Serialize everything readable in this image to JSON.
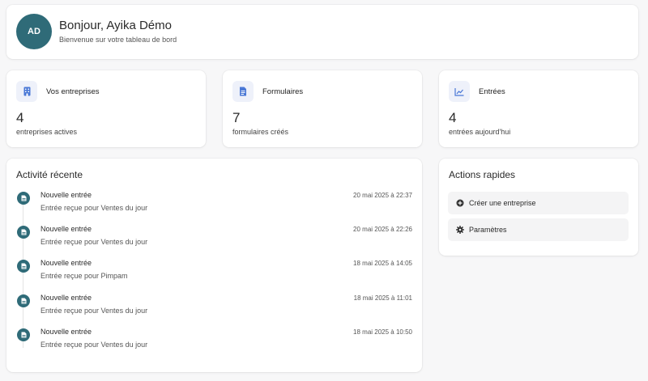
{
  "header": {
    "avatar_initials": "AD",
    "greeting": "Bonjour, Ayika Démo",
    "subtitle": "Bienvenue sur votre tableau de bord"
  },
  "stats": [
    {
      "label": "Vos entreprises",
      "value": "4",
      "description": "entreprises actives",
      "icon": "building-icon"
    },
    {
      "label": "Formulaires",
      "value": "7",
      "description": "formulaires créés",
      "icon": "document-icon"
    },
    {
      "label": "Entrées",
      "value": "4",
      "description": "entrées aujourd'hui",
      "icon": "line-chart-icon"
    }
  ],
  "activity": {
    "title": "Activité récente",
    "items": [
      {
        "title": "Nouvelle entrée",
        "description": "Entrée reçue pour Ventes du jour",
        "time": "20 mai 2025 à 22:37"
      },
      {
        "title": "Nouvelle entrée",
        "description": "Entrée reçue pour Ventes du jour",
        "time": "20 mai 2025 à 22:26"
      },
      {
        "title": "Nouvelle entrée",
        "description": "Entrée reçue pour Pimpam",
        "time": "18 mai 2025 à 14:05"
      },
      {
        "title": "Nouvelle entrée",
        "description": "Entrée reçue pour Ventes du jour",
        "time": "18 mai 2025 à 11:01"
      },
      {
        "title": "Nouvelle entrée",
        "description": "Entrée reçue pour Ventes du jour",
        "time": "18 mai 2025 à 10:50"
      }
    ]
  },
  "quick_actions": {
    "title": "Actions rapides",
    "items": [
      {
        "label": "Créer une entreprise",
        "icon": "plus-circle-icon"
      },
      {
        "label": "Paramètres",
        "icon": "gear-icon"
      }
    ]
  },
  "colors": {
    "accent": "#2f6b78",
    "icon_blue": "#4a78d6",
    "background": "#f7f7f8"
  }
}
